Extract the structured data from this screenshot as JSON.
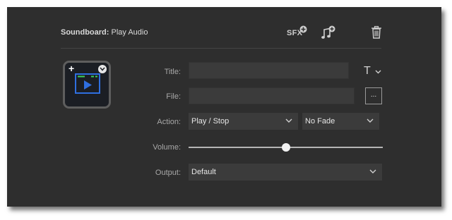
{
  "header": {
    "title_bold": "Soundboard:",
    "title_rest": " Play Audio",
    "sfx_label": "SFX",
    "sfx_icon": "add-sound-effect-icon",
    "music_icon": "add-music-icon",
    "trash_icon": "trash-icon"
  },
  "thumbnail": {
    "plus": "+",
    "icon": "play-screen-icon",
    "chevron_icon": "chevron-down-icon",
    "accent": "#2f6fe0",
    "green": "#3cd25a"
  },
  "form": {
    "title": {
      "label": "Title:",
      "value": "",
      "font_icon": "T"
    },
    "file": {
      "label": "File:",
      "value": "",
      "browse_label": "..."
    },
    "action": {
      "label": "Action:",
      "selected": "Play / Stop",
      "fade_selected": "No Fade"
    },
    "volume": {
      "label": "Volume:",
      "level_fraction": 0.5
    },
    "output": {
      "label": "Output:",
      "selected": "Default"
    }
  },
  "colors": {
    "panel_bg": "#2e2e2e",
    "field_bg": "#3b3b3b",
    "text": "#e6e6e6",
    "label": "#a8a8a8"
  }
}
